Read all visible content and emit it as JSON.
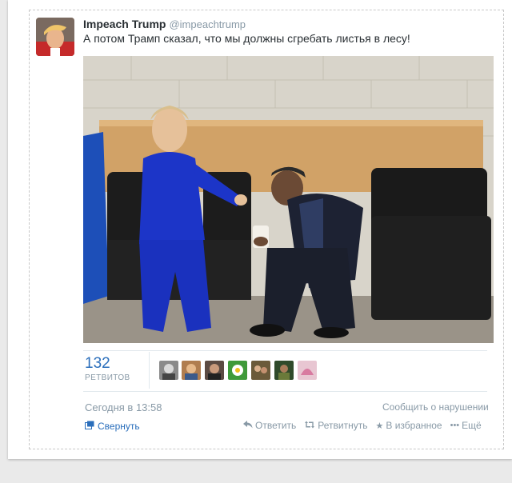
{
  "tweet": {
    "name": "Impeach Trump",
    "handle": "@impeachtrump",
    "text": "А потом Трамп сказал, что мы должны сгребать листья в лесу!",
    "retweet_count": "132",
    "retweet_label": "РЕТВИТОВ",
    "timestamp": "Сегодня в 13:58",
    "report_label": "Сообщить о нарушении",
    "collapse_label": "Свернуть",
    "actions": {
      "reply": "Ответить",
      "retweet": "Ретвитнуть",
      "favorite": "В избранное",
      "more": "Ещё"
    }
  },
  "colors": {
    "link": "#2a6ebb",
    "muted": "#8899a6",
    "separator": "#e1e8ed"
  },
  "icons": [
    "reply-icon",
    "retweet-icon",
    "star-icon",
    "more-icon",
    "collapse-icon"
  ]
}
